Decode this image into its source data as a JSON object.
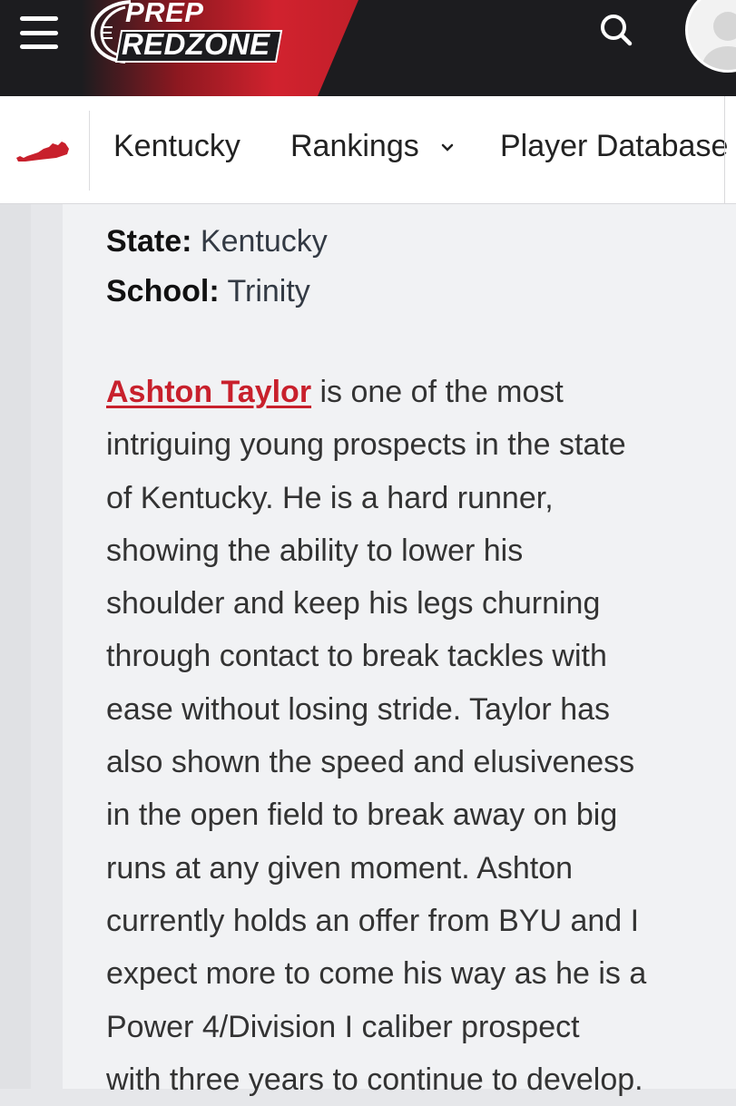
{
  "header": {
    "logo_top": "PREP",
    "logo_bottom": "REDZONE",
    "colors": {
      "bar": "#1c1c1f",
      "accent": "#c8202c"
    },
    "menu_icon": "hamburger-icon",
    "search_icon": "search-icon",
    "avatar_icon": "user-avatar-icon"
  },
  "subnav": {
    "state_icon": "kentucky-state-icon",
    "items": [
      {
        "label": "Kentucky"
      },
      {
        "label": "Rankings",
        "icon": "chevron-down-icon"
      },
      {
        "label": "Player Database"
      }
    ]
  },
  "player_info": {
    "state_label": "State:",
    "state_value": "Kentucky",
    "school_label": "School:",
    "school_value": "Trinity"
  },
  "article": {
    "player_link": "Ashton Taylor",
    "lines": [
      " is one of the most",
      "intriguing young prospects in the state",
      "of Kentucky. He is a hard runner,",
      "showing the ability to lower his",
      "shoulder and keep his legs churning",
      "through contact to break tackles with",
      "ease without losing stride. Taylor has",
      "also shown the speed and elusiveness",
      "in the open field to break away on big",
      "runs at any given moment. Ashton",
      "currently holds an offer from BYU and I",
      "expect more to come his way as he is a",
      "Power 4/Division I caliber prospect",
      "with three years to continue to develop."
    ]
  }
}
